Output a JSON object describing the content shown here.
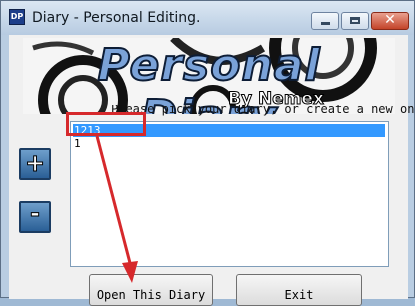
{
  "window": {
    "title": "Diary - Personal Editing.",
    "icon_text": "DP",
    "close_glyph": "✕"
  },
  "banner": {
    "title": "Personal Diary",
    "by": "By Nemex"
  },
  "instruction": "Please pick your diary, or create a new one.",
  "diary_list": {
    "items": [
      "1213",
      "1"
    ],
    "selected_index": 0
  },
  "buttons": {
    "add": "+",
    "remove": "-",
    "open": "Open This Diary",
    "exit": "Exit"
  },
  "colors": {
    "highlight": "#d6292c",
    "selection": "#3399ff"
  }
}
